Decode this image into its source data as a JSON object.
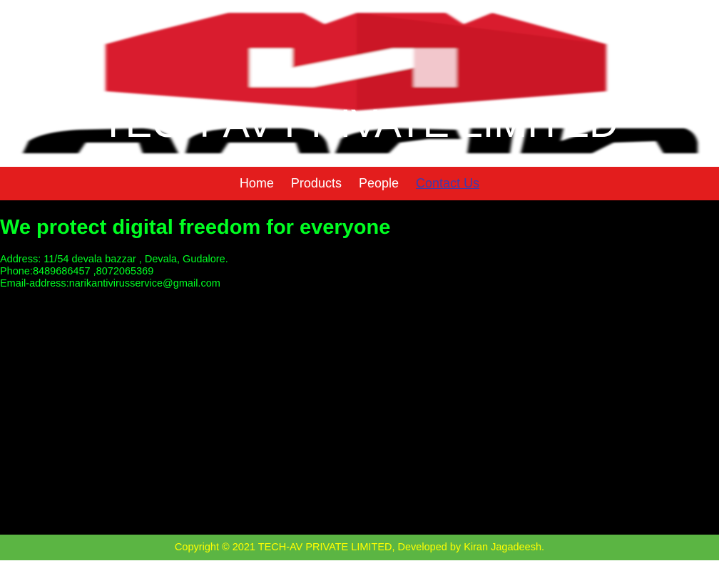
{
  "header": {
    "logo_text": "narik",
    "site_title": "TECH-AV PRIVATE LIMITED"
  },
  "nav": {
    "items": [
      {
        "label": "Home"
      },
      {
        "label": "Products"
      },
      {
        "label": "People"
      },
      {
        "label": "Contact Us"
      }
    ],
    "active": "Contact Us"
  },
  "main": {
    "headline": "We protect digital freedom for everyone",
    "address": "Address: 11/54 devala bazzar , Devala, Gudalore.",
    "phone": "Phone:8489686457 ,8072065369",
    "email": "Email-address:narikantivirusservice@gmail.com"
  },
  "footer": {
    "copyright": "Copyright © 2021 TECH-AV PRIVATE LIMITED, Developed by Kiran Jagadeesh."
  },
  "colors": {
    "nav_bg": "#e31d1d",
    "main_bg": "#000000",
    "text_green": "#00ff22",
    "footer_bg": "#5bb543",
    "footer_text": "#ffff00",
    "active_link": "#3a3ab0",
    "logo_red": "#d91c2e"
  },
  "icons": {
    "logo": "narik-logo-n-shield"
  }
}
